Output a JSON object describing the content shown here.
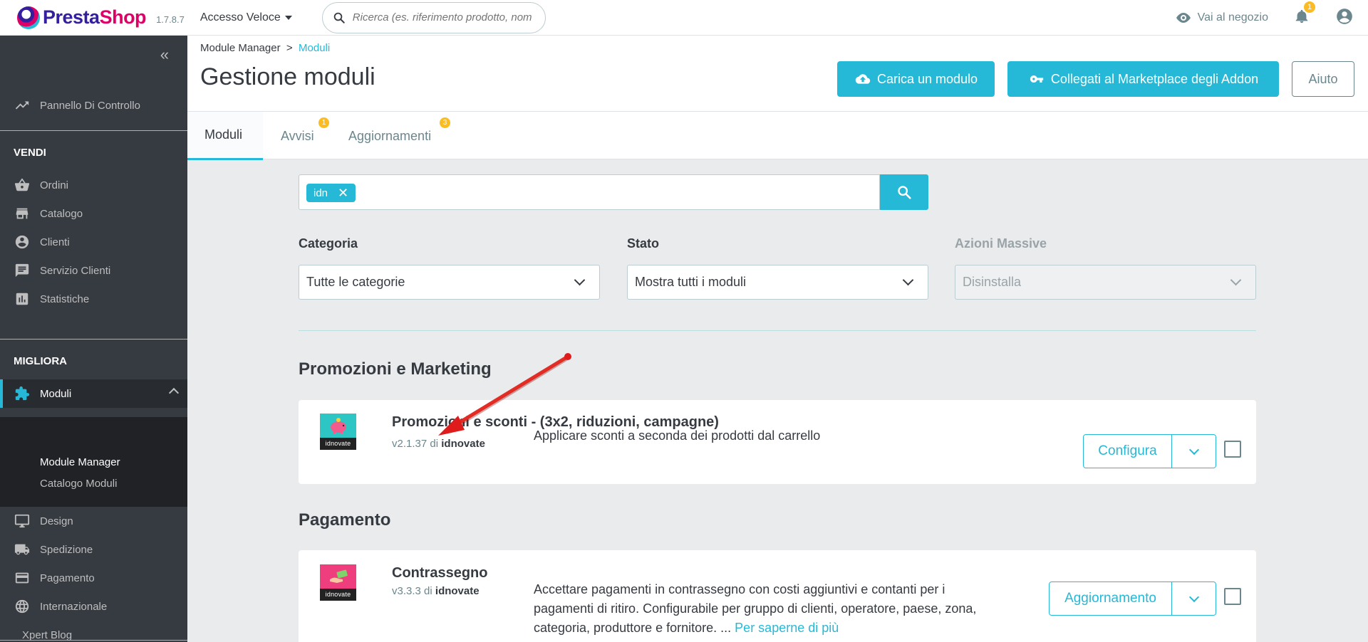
{
  "header": {
    "brand_part1": "Presta",
    "brand_part2": "Shop",
    "version": "1.7.8.7",
    "quick_access": "Accesso Veloce",
    "search_placeholder": "Ricerca (es. riferimento prodotto, nom",
    "shop_link": "Vai al negozio",
    "notification_count": "1"
  },
  "sidebar": {
    "collapse_glyph": "«",
    "dashboard": "Pannello Di Controllo",
    "section_sell": "VENDI",
    "orders": "Ordini",
    "catalog": "Catalogo",
    "customers": "Clienti",
    "customer_service": "Servizio Clienti",
    "stats": "Statistiche",
    "section_improve": "MIGLIORA",
    "modules": "Moduli",
    "module_manager": "Module Manager",
    "module_catalog": "Catalogo Moduli",
    "design": "Design",
    "shipping": "Spedizione",
    "payment": "Pagamento",
    "international": "Internazionale",
    "xpert_blog": "Xpert Blog"
  },
  "page": {
    "breadcrumb_parent": "Module Manager",
    "breadcrumb_sep": ">",
    "breadcrumb_current": "Moduli",
    "title": "Gestione moduli",
    "upload_button": "Carica un modulo",
    "marketplace_button": "Collegati al Marketplace degli Addon",
    "help_button": "Aiuto"
  },
  "tabs": [
    {
      "label": "Moduli",
      "badge": ""
    },
    {
      "label": "Avvisi",
      "badge": "1"
    },
    {
      "label": "Aggiornamenti",
      "badge": "3"
    }
  ],
  "filter": {
    "tag": "idn",
    "tag_remove": "✕",
    "category_label": "Categoria",
    "category_value": "Tutte le categorie",
    "status_label": "Stato",
    "status_value": "Mostra tutti i moduli",
    "bulk_label": "Azioni Massive",
    "bulk_value": "Disinstalla"
  },
  "categories": [
    {
      "title": "Promozioni e Marketing",
      "module": {
        "logo_text": "idnovate",
        "name": "Promozioni e sconti - (3x2, riduzioni, campagne)",
        "version": "v2.1.37",
        "by": "di",
        "author": "idnovate",
        "description": "Applicare sconti a seconda dei prodotti dal carrello",
        "action": "Configura"
      }
    },
    {
      "title": "Pagamento",
      "module": {
        "logo_text": "idnovate",
        "name": "Contrassegno",
        "version": "v3.3.3",
        "by": "di",
        "author": "idnovate",
        "description_lines": [
          "Accettare pagamenti in contrassegno con costi aggiuntivi e contanti per i",
          "pagamenti di ritiro. Configurabile per gruppo di clienti, operatore, paese, zona,",
          "categoria, produttore e fornitore. ..."
        ],
        "more": "Per saperne di più",
        "action": "Aggiornamento"
      }
    }
  ],
  "colors": {
    "accent": "#25b9d7",
    "sidebar_bg": "#363a41",
    "badge": "#fbbb22",
    "annotation_arrow": "#e01b1b"
  }
}
